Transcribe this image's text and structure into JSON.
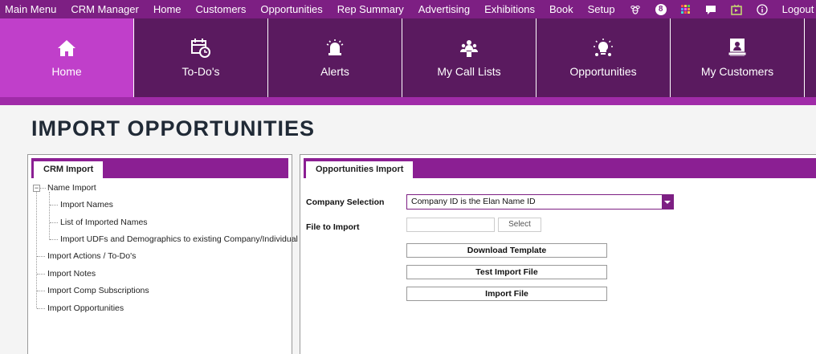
{
  "topmenu": {
    "items": [
      "Main Menu",
      "CRM Manager",
      "Home",
      "Customers",
      "Opportunities",
      "Rep Summary",
      "Advertising",
      "Exhibitions",
      "Book",
      "Setup"
    ],
    "icons": [
      "bee-icon",
      "number-badge-icon",
      "grid-icon",
      "chat-icon",
      "media-icon",
      "info-icon"
    ],
    "badge_number": "8",
    "logout": "Logout"
  },
  "tiles": [
    {
      "label": "Home",
      "icon": "home-icon"
    },
    {
      "label": "To-Do's",
      "icon": "calendar-clock-icon"
    },
    {
      "label": "Alerts",
      "icon": "alarm-icon"
    },
    {
      "label": "My Call Lists",
      "icon": "contacts-icon"
    },
    {
      "label": "Opportunities",
      "icon": "lightbulb-icon"
    },
    {
      "label": "My Customers",
      "icon": "customer-card-icon"
    }
  ],
  "page_title": "IMPORT OPPORTUNITIES",
  "left_panel": {
    "tab": "CRM Import",
    "tree": {
      "name_import": "Name Import",
      "children": [
        "Import Names",
        "List of Imported Names",
        "Import UDFs and Demographics to existing Company/Individual"
      ],
      "siblings": [
        "Import Actions / To-Do's",
        "Import Notes",
        "Import Comp Subscriptions",
        "Import Opportunities"
      ]
    }
  },
  "right_panel": {
    "tab": "Opportunities Import",
    "company_selection_label": "Company Selection",
    "company_selection_value": "Company ID is the Elan Name ID",
    "file_label": "File to Import",
    "select_button": "Select",
    "download_template": "Download Template",
    "test_import": "Test Import File",
    "import_file": "Import File"
  },
  "colors": {
    "menu_bar": "#7d1f83",
    "tile_dark": "#5a1a5f",
    "tile_active": "#c03fca",
    "accent": "#a02ba8"
  }
}
